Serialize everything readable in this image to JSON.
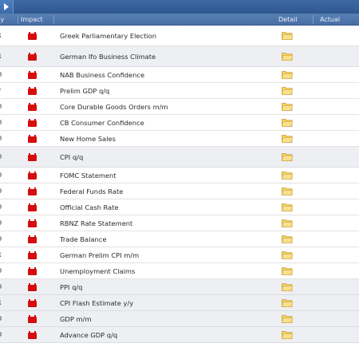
{
  "header": {
    "currency": "ncy",
    "impact": "Impact",
    "detail": "Detail",
    "actual": "Actual"
  },
  "colors": {
    "topbar": "#2e5790",
    "header": "#4f77ac",
    "impact_high": "#d40d0d",
    "folder": "#f2c94c",
    "row_alt": "#edeff3"
  },
  "rows": [
    {
      "currency": "R",
      "event": "Greek Parliamentary Election",
      "impact_icon": "high-impact-icon",
      "actual": ""
    },
    {
      "currency": "R",
      "event": "German Ifo Business Climate",
      "impact_icon": "high-impact-icon",
      "actual": ""
    },
    {
      "currency": "D",
      "event": "NAB Business Confidence",
      "impact_icon": "high-impact-icon",
      "actual": ""
    },
    {
      "currency": "P",
      "event": "Prelim GDP q/q",
      "impact_icon": "high-impact-icon",
      "actual": ""
    },
    {
      "currency": "D",
      "event": "Core Durable Goods Orders m/m",
      "impact_icon": "high-impact-icon",
      "actual": ""
    },
    {
      "currency": "D",
      "event": "CB Consumer Confidence",
      "impact_icon": "high-impact-icon",
      "actual": ""
    },
    {
      "currency": "D",
      "event": "New Home Sales",
      "impact_icon": "high-impact-icon",
      "actual": ""
    },
    {
      "currency": "D",
      "event": "CPI q/q",
      "impact_icon": "high-impact-icon",
      "actual": ""
    },
    {
      "currency": "D",
      "event": "FOMC Statement",
      "impact_icon": "high-impact-icon",
      "actual": ""
    },
    {
      "currency": "D",
      "event": "Federal Funds Rate",
      "impact_icon": "high-impact-icon",
      "actual": ""
    },
    {
      "currency": "D",
      "event": "Official Cash Rate",
      "impact_icon": "high-impact-icon",
      "actual": ""
    },
    {
      "currency": "D",
      "event": "RBNZ Rate Statement",
      "impact_icon": "high-impact-icon",
      "actual": ""
    },
    {
      "currency": "D",
      "event": "Trade Balance",
      "impact_icon": "high-impact-icon",
      "actual": ""
    },
    {
      "currency": "R",
      "event": "German Prelim CPI m/m",
      "impact_icon": "high-impact-icon",
      "actual": ""
    },
    {
      "currency": "D",
      "event": "Unemployment Claims",
      "impact_icon": "high-impact-icon",
      "actual": ""
    },
    {
      "currency": "D",
      "event": "PPI q/q",
      "impact_icon": "high-impact-icon",
      "actual": ""
    },
    {
      "currency": "R",
      "event": "CPI Flash Estimate y/y",
      "impact_icon": "high-impact-icon",
      "actual": ""
    },
    {
      "currency": "D",
      "event": "GDP m/m",
      "impact_icon": "high-impact-icon",
      "actual": ""
    },
    {
      "currency": "D",
      "event": "Advance GDP q/q",
      "impact_icon": "high-impact-icon",
      "actual": ""
    }
  ]
}
